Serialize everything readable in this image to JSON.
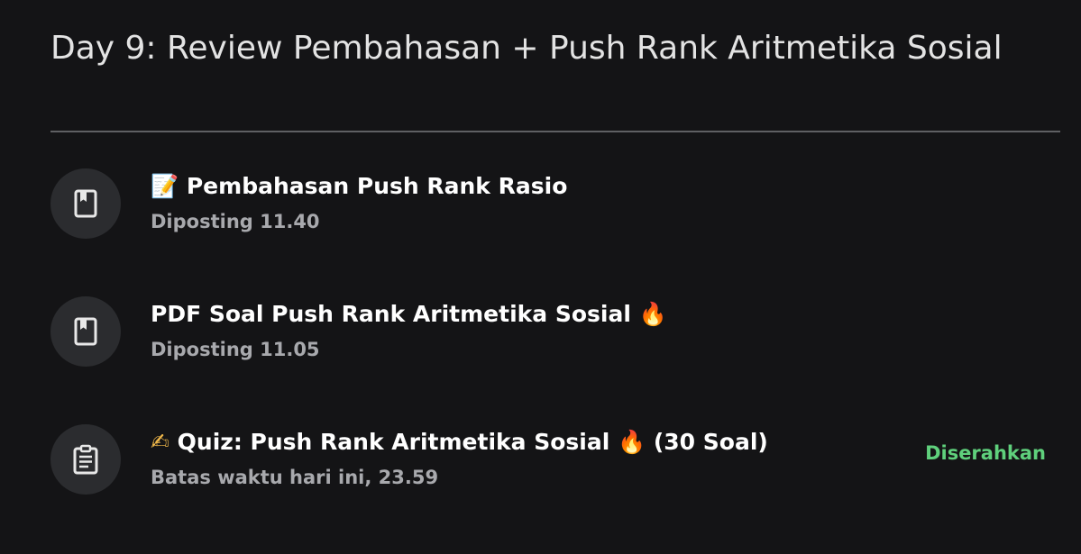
{
  "topic": {
    "title": "Day 9: Review Pembahasan + Push Rank Aritmetika Sosial"
  },
  "items": [
    {
      "icon": "material-icon",
      "prefix_emoji": "📝",
      "title": "Pembahasan Push Rank Rasio",
      "suffix_emoji": "",
      "suffix_text": "",
      "meta": "Diposting 11.40",
      "status": ""
    },
    {
      "icon": "material-icon",
      "prefix_emoji": "",
      "title": "PDF Soal Push Rank Aritmetika Sosial",
      "suffix_emoji": "🔥",
      "suffix_text": "",
      "meta": "Diposting 11.05",
      "status": ""
    },
    {
      "icon": "assignment-icon",
      "prefix_emoji": "✍",
      "title": "Quiz: Push Rank Aritmetika Sosial",
      "suffix_emoji": "🔥",
      "suffix_text": " (30 Soal)",
      "meta": "Batas waktu hari ini, 23.59",
      "status": "Diserahkan"
    }
  ],
  "colors": {
    "background": "#141416",
    "title_text": "#e3e3e3",
    "meta_text": "#a8a9ad",
    "icon_circle": "#2b2c2f",
    "status_green": "#5fd07c"
  }
}
